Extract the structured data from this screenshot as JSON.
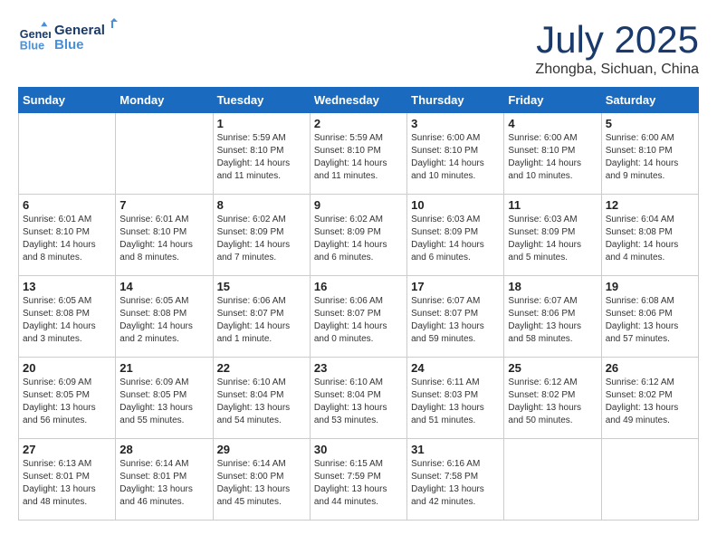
{
  "header": {
    "logo_line1": "General",
    "logo_line2": "Blue",
    "title": "July 2025",
    "subtitle": "Zhongba, Sichuan, China"
  },
  "calendar": {
    "days_of_week": [
      "Sunday",
      "Monday",
      "Tuesday",
      "Wednesday",
      "Thursday",
      "Friday",
      "Saturday"
    ],
    "weeks": [
      [
        {
          "day": "",
          "info": ""
        },
        {
          "day": "",
          "info": ""
        },
        {
          "day": "1",
          "info": "Sunrise: 5:59 AM\nSunset: 8:10 PM\nDaylight: 14 hours and 11 minutes."
        },
        {
          "day": "2",
          "info": "Sunrise: 5:59 AM\nSunset: 8:10 PM\nDaylight: 14 hours and 11 minutes."
        },
        {
          "day": "3",
          "info": "Sunrise: 6:00 AM\nSunset: 8:10 PM\nDaylight: 14 hours and 10 minutes."
        },
        {
          "day": "4",
          "info": "Sunrise: 6:00 AM\nSunset: 8:10 PM\nDaylight: 14 hours and 10 minutes."
        },
        {
          "day": "5",
          "info": "Sunrise: 6:00 AM\nSunset: 8:10 PM\nDaylight: 14 hours and 9 minutes."
        }
      ],
      [
        {
          "day": "6",
          "info": "Sunrise: 6:01 AM\nSunset: 8:10 PM\nDaylight: 14 hours and 8 minutes."
        },
        {
          "day": "7",
          "info": "Sunrise: 6:01 AM\nSunset: 8:10 PM\nDaylight: 14 hours and 8 minutes."
        },
        {
          "day": "8",
          "info": "Sunrise: 6:02 AM\nSunset: 8:09 PM\nDaylight: 14 hours and 7 minutes."
        },
        {
          "day": "9",
          "info": "Sunrise: 6:02 AM\nSunset: 8:09 PM\nDaylight: 14 hours and 6 minutes."
        },
        {
          "day": "10",
          "info": "Sunrise: 6:03 AM\nSunset: 8:09 PM\nDaylight: 14 hours and 6 minutes."
        },
        {
          "day": "11",
          "info": "Sunrise: 6:03 AM\nSunset: 8:09 PM\nDaylight: 14 hours and 5 minutes."
        },
        {
          "day": "12",
          "info": "Sunrise: 6:04 AM\nSunset: 8:08 PM\nDaylight: 14 hours and 4 minutes."
        }
      ],
      [
        {
          "day": "13",
          "info": "Sunrise: 6:05 AM\nSunset: 8:08 PM\nDaylight: 14 hours and 3 minutes."
        },
        {
          "day": "14",
          "info": "Sunrise: 6:05 AM\nSunset: 8:08 PM\nDaylight: 14 hours and 2 minutes."
        },
        {
          "day": "15",
          "info": "Sunrise: 6:06 AM\nSunset: 8:07 PM\nDaylight: 14 hours and 1 minute."
        },
        {
          "day": "16",
          "info": "Sunrise: 6:06 AM\nSunset: 8:07 PM\nDaylight: 14 hours and 0 minutes."
        },
        {
          "day": "17",
          "info": "Sunrise: 6:07 AM\nSunset: 8:07 PM\nDaylight: 13 hours and 59 minutes."
        },
        {
          "day": "18",
          "info": "Sunrise: 6:07 AM\nSunset: 8:06 PM\nDaylight: 13 hours and 58 minutes."
        },
        {
          "day": "19",
          "info": "Sunrise: 6:08 AM\nSunset: 8:06 PM\nDaylight: 13 hours and 57 minutes."
        }
      ],
      [
        {
          "day": "20",
          "info": "Sunrise: 6:09 AM\nSunset: 8:05 PM\nDaylight: 13 hours and 56 minutes."
        },
        {
          "day": "21",
          "info": "Sunrise: 6:09 AM\nSunset: 8:05 PM\nDaylight: 13 hours and 55 minutes."
        },
        {
          "day": "22",
          "info": "Sunrise: 6:10 AM\nSunset: 8:04 PM\nDaylight: 13 hours and 54 minutes."
        },
        {
          "day": "23",
          "info": "Sunrise: 6:10 AM\nSunset: 8:04 PM\nDaylight: 13 hours and 53 minutes."
        },
        {
          "day": "24",
          "info": "Sunrise: 6:11 AM\nSunset: 8:03 PM\nDaylight: 13 hours and 51 minutes."
        },
        {
          "day": "25",
          "info": "Sunrise: 6:12 AM\nSunset: 8:02 PM\nDaylight: 13 hours and 50 minutes."
        },
        {
          "day": "26",
          "info": "Sunrise: 6:12 AM\nSunset: 8:02 PM\nDaylight: 13 hours and 49 minutes."
        }
      ],
      [
        {
          "day": "27",
          "info": "Sunrise: 6:13 AM\nSunset: 8:01 PM\nDaylight: 13 hours and 48 minutes."
        },
        {
          "day": "28",
          "info": "Sunrise: 6:14 AM\nSunset: 8:01 PM\nDaylight: 13 hours and 46 minutes."
        },
        {
          "day": "29",
          "info": "Sunrise: 6:14 AM\nSunset: 8:00 PM\nDaylight: 13 hours and 45 minutes."
        },
        {
          "day": "30",
          "info": "Sunrise: 6:15 AM\nSunset: 7:59 PM\nDaylight: 13 hours and 44 minutes."
        },
        {
          "day": "31",
          "info": "Sunrise: 6:16 AM\nSunset: 7:58 PM\nDaylight: 13 hours and 42 minutes."
        },
        {
          "day": "",
          "info": ""
        },
        {
          "day": "",
          "info": ""
        }
      ]
    ]
  }
}
